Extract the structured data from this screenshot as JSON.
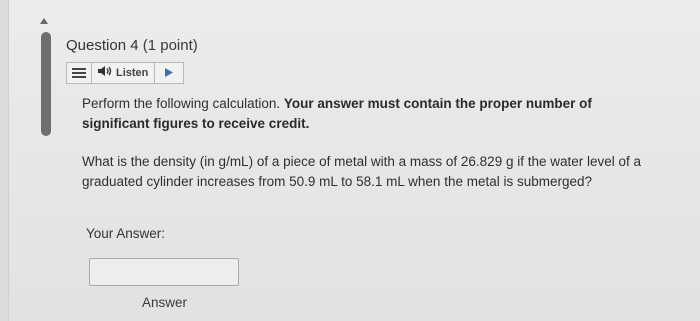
{
  "question": {
    "title": "Question 4",
    "points": "(1 point)"
  },
  "toolbar": {
    "listen_label": "Listen"
  },
  "instructions": {
    "plain": "Perform the following calculation.",
    "bold": "Your answer must contain the proper number of significant figures to receive credit."
  },
  "prompt": "What is the density (in g/mL) of a piece of metal with a mass of 26.829 g if the water level of a graduated cylinder increases from 50.9 mL to 58.1 mL when the metal is submerged?",
  "answer": {
    "label": "Your Answer:",
    "value": "",
    "caption": "Answer"
  },
  "icons": {
    "menu": "menu-icon",
    "speaker": "speaker-icon",
    "play": "play-icon"
  }
}
